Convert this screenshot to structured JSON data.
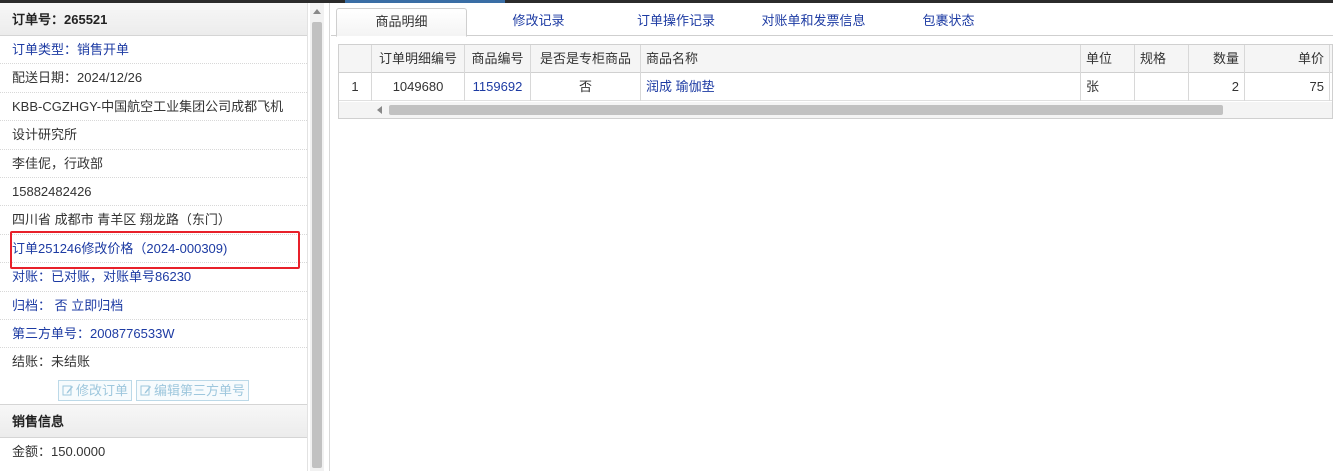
{
  "order_panel": {
    "title": "订单号：265521",
    "order_type": "订单类型：销售开单",
    "delivery_date": "配送日期：2024/12/26",
    "company_line1": "KBB-CGZHGY-中国航空工业集团公司成都飞机",
    "company_line2": "设计研究所",
    "contact": "李佳伲，行政部",
    "phone": "15882482426",
    "address": "四川省 成都市 青羊区 翔龙路（东门）",
    "price_change": "订单251246修改价格（2024-000309)",
    "reconcile": "对账：已对账，对账单号86230",
    "archive": "归档： 否 立即归档",
    "third_party": "第三方单号：2008776533W",
    "settlement": "结账：未结账",
    "edit_order_button": "修改订单",
    "edit_third_party_button": "编辑第三方单号"
  },
  "sales_panel": {
    "title": "销售信息",
    "amount": "金额：150.0000"
  },
  "tabs": [
    {
      "label": "商品明细",
      "active": true
    },
    {
      "label": "修改记录",
      "active": false
    },
    {
      "label": "订单操作记录",
      "active": false
    },
    {
      "label": "对账单和发票信息",
      "active": false
    },
    {
      "label": "包裹状态",
      "active": false
    }
  ],
  "grid": {
    "columns": [
      "",
      "订单明细编号",
      "商品编号",
      "是否是专柜商品",
      "商品名称",
      "单位",
      "规格",
      "数量",
      "单价"
    ],
    "rows": [
      {
        "index": "1",
        "detail_id": "1049680",
        "product_id": "1159692",
        "is_counter": "否",
        "name": "润成 瑜伽垫",
        "unit": "张",
        "spec": "",
        "qty": "2",
        "price": "75"
      }
    ]
  },
  "colors": {
    "link": "#1d3ba3",
    "highlight": "#e8202a"
  }
}
